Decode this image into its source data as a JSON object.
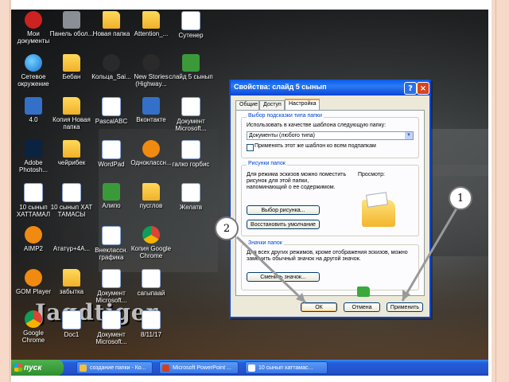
{
  "desktop": {
    "watermark": "Jagdtiger",
    "icons": [
      {
        "label": "Мои документы",
        "icon": "my-documents-icon",
        "style": "red"
      },
      {
        "label": "Панель обол...",
        "icon": "panel-icon",
        "style": "gray"
      },
      {
        "label": "Новая папка",
        "icon": "folder-icon",
        "style": "folder"
      },
      {
        "label": "Attention_...",
        "icon": "folder-icon",
        "style": "folder"
      },
      {
        "label": "Сутенер",
        "icon": "word-doc-icon",
        "style": "doc"
      },
      {
        "label": "Сетевое окружение",
        "icon": "network-icon",
        "style": "globe"
      },
      {
        "label": "Бебан",
        "icon": "folder-icon",
        "style": "folder"
      },
      {
        "label": "Кольца_Sai...",
        "icon": "media-icon",
        "style": "dark"
      },
      {
        "label": "New Stories (Highway...",
        "icon": "media-icon",
        "style": "dark"
      },
      {
        "label": "слайд 5 сынып",
        "icon": "folder-icon",
        "style": "green"
      },
      {
        "label": "4.0",
        "icon": "recycle-bin-icon",
        "style": "blue"
      },
      {
        "label": "Копия Новая папка",
        "icon": "folder-icon",
        "style": "folder"
      },
      {
        "label": "PascalABC",
        "icon": "pascal-icon",
        "style": "doc"
      },
      {
        "label": "Вконтакте",
        "icon": "vk-icon",
        "style": "blue"
      },
      {
        "label": "Документ Microsoft...",
        "icon": "word-doc-icon",
        "style": "doc"
      },
      {
        "label": "Adobe Photosh...",
        "icon": "photoshop-icon",
        "style": "ps"
      },
      {
        "label": "чейрибек",
        "icon": "folder-icon",
        "style": "folder"
      },
      {
        "label": "WordPad",
        "icon": "wordpad-icon",
        "style": "doc"
      },
      {
        "label": "Одноклассн...",
        "icon": "ok-icon",
        "style": "orange"
      },
      {
        "label": "галко горбис",
        "icon": "word-doc-icon",
        "style": "doc"
      },
      {
        "label": "10 сынып ХАТТАМАЛ",
        "icon": "word-doc-icon",
        "style": "doc"
      },
      {
        "label": "10 сынып ХАТ ТАМАСЫ",
        "icon": "word-doc-icon",
        "style": "doc"
      },
      {
        "label": "Алипо",
        "icon": "app-icon",
        "style": "green"
      },
      {
        "label": "пусглов",
        "icon": "folder-icon",
        "style": "folder"
      },
      {
        "label": "Желатв",
        "icon": "word-doc-icon",
        "style": "doc"
      },
      {
        "label": "AIMP2",
        "icon": "aimp-icon",
        "style": "orange"
      },
      {
        "label": "Ататүр+4А...",
        "icon": "media-icon",
        "style": "dark"
      },
      {
        "label": "Внеклассн. графика",
        "icon": "word-doc-icon",
        "style": "doc"
      },
      {
        "label": "Копия Google Chrome",
        "icon": "chrome-icon",
        "style": "chrome"
      },
      {
        "label": "",
        "icon": "none",
        "style": "none"
      },
      {
        "label": "GOM Player",
        "icon": "gom-icon",
        "style": "orange"
      },
      {
        "label": "забытка",
        "icon": "warning-icon",
        "style": "folder"
      },
      {
        "label": "Документ Microsoft...",
        "icon": "word-doc-icon",
        "style": "doc"
      },
      {
        "label": "сагыпаай",
        "icon": "word-doc-icon",
        "style": "doc"
      },
      {
        "label": "",
        "icon": "none",
        "style": "none"
      },
      {
        "label": "Google Chrome",
        "icon": "chrome-icon",
        "style": "chrome"
      },
      {
        "label": "Doc1",
        "icon": "word-doc-icon",
        "style": "doc"
      },
      {
        "label": "Документ Microsoft...",
        "icon": "word-doc-icon",
        "style": "doc"
      },
      {
        "label": "8/11/17",
        "icon": "word-doc-icon",
        "style": "doc"
      }
    ]
  },
  "dialog": {
    "title": "Свойства: слайд 5 сынып",
    "help_glyph": "?",
    "close_glyph": "×",
    "tabs": [
      "Общие",
      "Доступ",
      "Настройка"
    ],
    "active_tab": "Настройка",
    "group1": {
      "legend": "Выбор подсказки типа папки",
      "prompt": "Использовать в качестве шаблона следующую папку:",
      "combo_value": "Документы (любого типа)",
      "checkbox_label": "Применять этот же шаблон ко всем подпапкам"
    },
    "group2": {
      "legend": "Рисунки папок",
      "description": "Для режима эскизов можно поместить рисунок для этой папки, напоминающий о ее содержимом.",
      "preview_label": "Просмотр:",
      "choose_button": "Выбор рисунка...",
      "restore_button": "Восстановить умолчание"
    },
    "group3": {
      "legend": "Значки папок",
      "description": "Для всех других режимов, кроме отображения эскизов, можно заменить обычный значок на другой значок.",
      "change_button": "Сменить значок..."
    },
    "ok_button": "ОК",
    "cancel_button": "Отмена",
    "apply_button": "Применить"
  },
  "callouts": {
    "first": "1",
    "second": "2"
  },
  "taskbar": {
    "start_label": "пуск",
    "tasks": [
      "создание папки - Ко...",
      "Microsoft PowerPoint ...",
      "10 сынып хаттамас..."
    ]
  }
}
